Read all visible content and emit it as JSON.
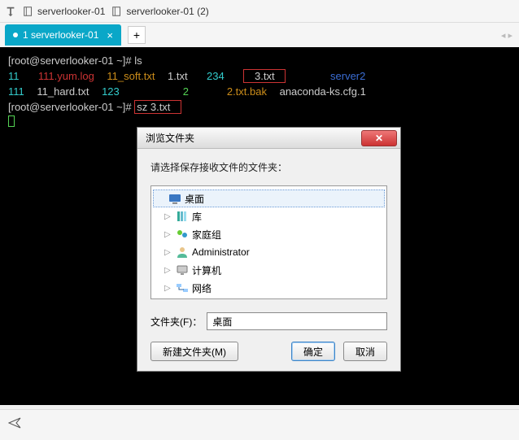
{
  "toolbar": {
    "sessions": [
      "serverlooker-01",
      "serverlooker-01 (2)"
    ]
  },
  "tabs": {
    "active_label": "1 serverlooker-01"
  },
  "terminal": {
    "prompt1_user": "root@serverlooker-01",
    "prompt1_path": "~",
    "prompt1_cmd": "ls",
    "row1": {
      "c1": "11",
      "c2": "111.yum.log",
      "c3": "11_soft.txt",
      "c4": "1.txt",
      "c5": "234",
      "c6": "3.txt",
      "c7": "server2"
    },
    "row2": {
      "c1": "111",
      "c2": "11_hard.txt",
      "c3": "123",
      "c4": "2",
      "c5": "2.txt.bak",
      "c6": "anaconda-ks.cfg.1"
    },
    "prompt2_user": "root@serverlooker-01",
    "prompt2_path": "~",
    "prompt2_cmd": "sz 3.txt"
  },
  "dialog": {
    "title": "浏览文件夹",
    "prompt": "请选择保存接收文件的文件夹：",
    "tree": [
      {
        "label": "桌面",
        "icon": "desktop",
        "selected": true,
        "expandable": false
      },
      {
        "label": "库",
        "icon": "library",
        "child": true,
        "expandable": true
      },
      {
        "label": "家庭组",
        "icon": "homegroup",
        "child": true,
        "expandable": true
      },
      {
        "label": "Administrator",
        "icon": "user",
        "child": true,
        "expandable": true
      },
      {
        "label": "计算机",
        "icon": "computer",
        "child": true,
        "expandable": true
      },
      {
        "label": "网络",
        "icon": "network",
        "child": true,
        "expandable": true
      }
    ],
    "folder_label": "文件夹(F)：",
    "folder_value": "桌面",
    "btn_new": "新建文件夹(M)",
    "btn_ok": "确定",
    "btn_cancel": "取消"
  }
}
